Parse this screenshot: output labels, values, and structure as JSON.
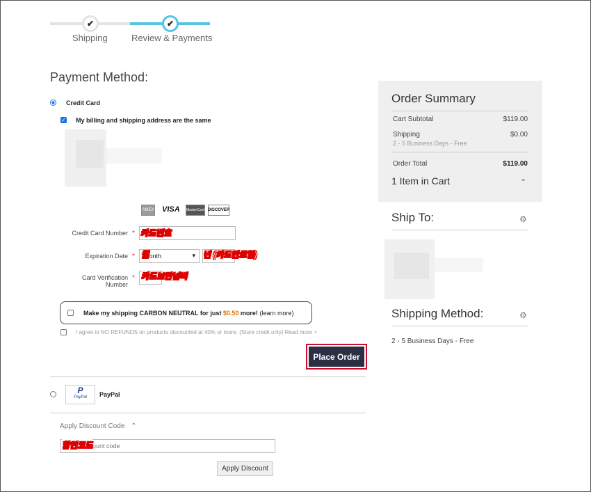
{
  "progress": {
    "steps": [
      {
        "label": "Shipping",
        "check": "✔"
      },
      {
        "label": "Review & Payments",
        "check": "✔"
      }
    ]
  },
  "payment": {
    "title": "Payment Method:",
    "credit_card_label": "Credit Card",
    "billing_same_label": "My billing and shipping address are the same",
    "card_logos": [
      "AMEX",
      "VISA",
      "MasterCard",
      "DISCOVER"
    ],
    "card_number_label": "Credit Card Number",
    "card_number_annotation": "카드번호",
    "expiration_label": "Expiration Date",
    "month_value": "Month",
    "month_annotation": "월",
    "year_annotation": "년 (카드만료일)",
    "cvv_label_line1": "Card Verification",
    "cvv_label_line2": "Number",
    "cvv_annotation": "카드보안넘버",
    "required_mark": "*",
    "carbon_text": "Make my shipping CARBON NEUTRAL for just",
    "carbon_price": "$0.50",
    "carbon_more": "more!",
    "carbon_link": "(learn more)",
    "refund_text": "I agree to NO REFUNDS on products discounted at 40% or more. (Store credit only) Read more >",
    "place_order": "Place Order",
    "paypal_label": "PayPal",
    "paypal_logo_text": "PayPal"
  },
  "discount": {
    "toggle_label": "Apply Discount Code",
    "toggle_icon": "⌃",
    "placeholder": "Enter discount code",
    "annotation": "할인코드",
    "apply_label": "Apply Discount"
  },
  "summary": {
    "title": "Order Summary",
    "rows": [
      {
        "label": "Cart Subtotal",
        "value": "$119.00"
      },
      {
        "label": "Shipping",
        "value": "$0.00",
        "sub": "2 - 5 Business Days - Free"
      },
      {
        "label": "Order Total",
        "value": "$119.00"
      }
    ],
    "cart_items": "1 Item in Cart",
    "chevron": "⌄"
  },
  "ship_to": {
    "title": "Ship To:",
    "gear": "⚙"
  },
  "shipping_method": {
    "title": "Shipping Method:",
    "gear": "⚙",
    "value": "2 - 5 Business Days - Free"
  },
  "colors": {
    "accent": "#57c3e0",
    "button": "#2a2f43",
    "highlight": "#c8102e",
    "price": "#e07000"
  }
}
